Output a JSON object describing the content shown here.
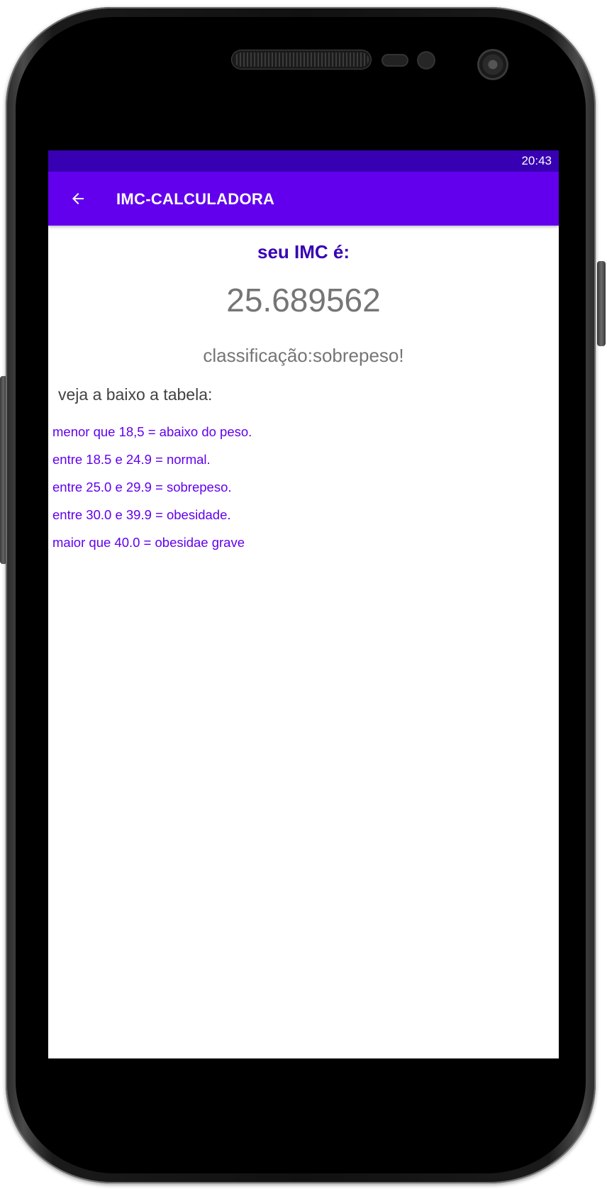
{
  "status_bar": {
    "time": "20:43",
    "color": "#3700b3"
  },
  "app_bar": {
    "title": "IMC-CALCULADORA",
    "back_icon": "arrow-back-icon",
    "color": "#6200ee"
  },
  "result": {
    "heading": "seu IMC é:",
    "value": "25.689562",
    "classification": "classificação:sobrepeso!"
  },
  "table": {
    "intro": "veja a baixo a tabela:",
    "items": [
      "menor que 18,5 = abaixo do peso.",
      "entre 18.5 e 24.9 = normal.",
      "entre 25.0 e 29.9 = sobrepeso.",
      "entre 30.0 e 39.9 = obesidade.",
      "maior que 40.0 = obesidae grave"
    ]
  },
  "colors": {
    "accent": "#6200ee",
    "heading": "#3700b3",
    "value_text": "#757575"
  }
}
